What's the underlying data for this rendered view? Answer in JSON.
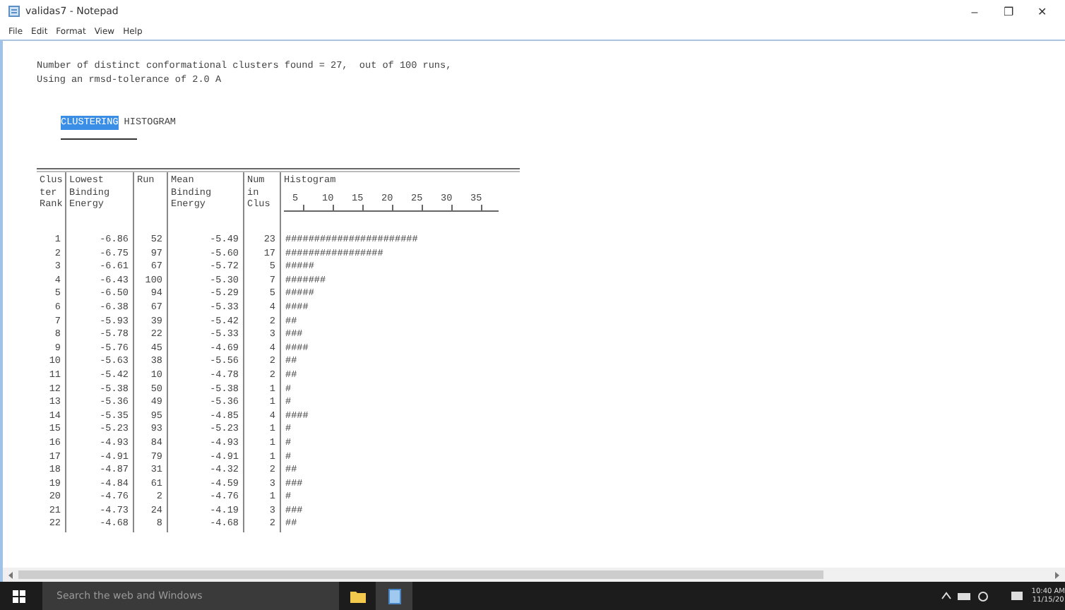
{
  "window": {
    "title": "validas7 - Notepad",
    "controls": [
      "–",
      "❐",
      "✕"
    ]
  },
  "menu": [
    "File",
    "Edit",
    "Format",
    "View",
    "Help"
  ],
  "document": {
    "intro": [
      "Number of distinct conformational clusters found = 27,  out of 100 runs,",
      "Using an rmsd-tolerance of 2.0 A"
    ],
    "heading": [
      {
        "text": "CLUSTERING",
        "selected": true
      },
      {
        "text": "HISTOGRAM",
        "selected": false
      }
    ],
    "table": {
      "columns": [
        "Clus\nter\nRank",
        "Lowest\nBinding\nEnergy",
        "Run",
        "Mean\nBinding\nEnergy",
        "Num\nin\nClus",
        "Histogram"
      ],
      "histogram_ticks": [
        "5",
        "10",
        "15",
        "20",
        "25",
        "30",
        "35"
      ],
      "rows": [
        [
          "1",
          "-6.86",
          "52",
          "-5.49",
          "23",
          "#######################"
        ],
        [
          "2",
          "-6.75",
          "97",
          "-5.60",
          "17",
          "#################"
        ],
        [
          "3",
          "-6.61",
          "67",
          "-5.72",
          "5",
          "#####"
        ],
        [
          "4",
          "-6.43",
          "100",
          "-5.30",
          "7",
          "#######"
        ],
        [
          "5",
          "-6.50",
          "94",
          "-5.29",
          "5",
          "#####"
        ],
        [
          "6",
          "-6.38",
          "67",
          "-5.33",
          "4",
          "####"
        ],
        [
          "7",
          "-5.93",
          "39",
          "-5.42",
          "2",
          "##"
        ],
        [
          "8",
          "-5.78",
          "22",
          "-5.33",
          "3",
          "###"
        ],
        [
          "9",
          "-5.76",
          "45",
          "-4.69",
          "4",
          "####"
        ],
        [
          "10",
          "-5.63",
          "38",
          "-5.56",
          "2",
          "##"
        ],
        [
          "11",
          "-5.42",
          "10",
          "-4.78",
          "2",
          "##"
        ],
        [
          "12",
          "-5.38",
          "50",
          "-5.38",
          "1",
          "#"
        ],
        [
          "13",
          "-5.36",
          "49",
          "-5.36",
          "1",
          "#"
        ],
        [
          "14",
          "-5.35",
          "95",
          "-4.85",
          "4",
          "####"
        ],
        [
          "15",
          "-5.23",
          "93",
          "-5.23",
          "1",
          "#"
        ],
        [
          "16",
          "-4.93",
          "84",
          "-4.93",
          "1",
          "#"
        ],
        [
          "17",
          "-4.91",
          "79",
          "-4.91",
          "1",
          "#"
        ],
        [
          "18",
          "-4.87",
          "31",
          "-4.32",
          "2",
          "##"
        ],
        [
          "19",
          "-4.84",
          "61",
          "-4.59",
          "3",
          "###"
        ],
        [
          "20",
          "-4.76",
          "2",
          "-4.76",
          "1",
          "#"
        ],
        [
          "21",
          "-4.73",
          "24",
          "-4.19",
          "3",
          "###"
        ],
        [
          "22",
          "-4.68",
          "8",
          "-4.68",
          "2",
          "##"
        ]
      ]
    }
  },
  "taskbar": {
    "search_placeholder": "Search the web and Windows",
    "clock": {
      "time": "10:40 AM",
      "date": "11/15/20"
    }
  }
}
